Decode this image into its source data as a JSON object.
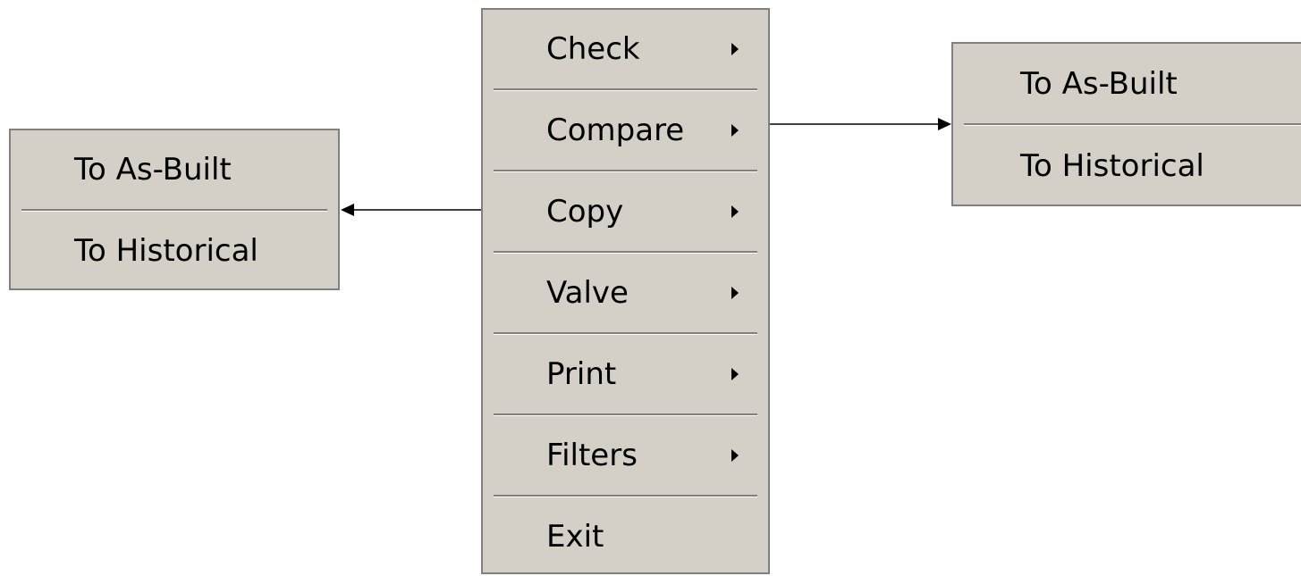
{
  "main_menu": {
    "items": [
      {
        "label": "Check",
        "has_submenu": true
      },
      {
        "label": "Compare",
        "has_submenu": true
      },
      {
        "label": "Copy",
        "has_submenu": true
      },
      {
        "label": "Valve",
        "has_submenu": true
      },
      {
        "label": "Print",
        "has_submenu": true
      },
      {
        "label": "Filters",
        "has_submenu": true
      },
      {
        "label": "Exit",
        "has_submenu": false
      }
    ]
  },
  "left_submenu": {
    "items": [
      {
        "label": "To As-Built"
      },
      {
        "label": "To Historical"
      }
    ]
  },
  "right_submenu": {
    "items": [
      {
        "label": "To As-Built"
      },
      {
        "label": "To Historical"
      }
    ]
  },
  "colors": {
    "menu_background": "#d4d0c8",
    "menu_border": "#808080",
    "separator_shadow": "#808080",
    "separator_highlight": "#ffffff",
    "text": "#000000",
    "connector": "#000000"
  }
}
